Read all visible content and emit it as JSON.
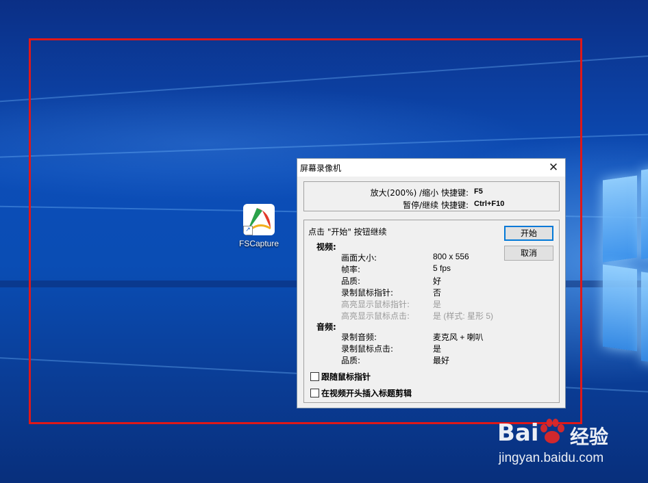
{
  "desktop": {
    "icon_label": "FSCapture"
  },
  "dialog": {
    "title": "屏幕录像机",
    "close_glyph": "✕",
    "hotkeys": {
      "zoom_label": "放大(200%) /缩小 快捷键:",
      "zoom_key": "F5",
      "pause_label": "暂停/继续 快捷键:",
      "pause_key": "Ctrl+F10"
    },
    "prompt": "点击 \"开始\" 按钮继续",
    "start_button": "开始",
    "cancel_button": "取消",
    "video": {
      "heading": "视频:",
      "items": [
        {
          "label": "画面大小:",
          "value": "800 x 556",
          "disabled": false
        },
        {
          "label": "帧率:",
          "value": "5 fps",
          "disabled": false
        },
        {
          "label": "品质:",
          "value": "好",
          "disabled": false
        },
        {
          "label": "录制鼠标指针:",
          "value": "否",
          "disabled": false
        },
        {
          "label": "高亮显示鼠标指针:",
          "value": "是",
          "disabled": true
        },
        {
          "label": "高亮显示鼠标点击:",
          "value": "是 (样式: 星形 5)",
          "disabled": true
        }
      ]
    },
    "audio": {
      "heading": "音频:",
      "items": [
        {
          "label": "录制音频:",
          "value": "麦克风 + 喇叭"
        },
        {
          "label": "录制鼠标点击:",
          "value": "是"
        },
        {
          "label": "品质:",
          "value": "最好"
        }
      ]
    },
    "checkboxes": [
      {
        "label": "跟随鼠标指针",
        "checked": false
      },
      {
        "label": "在视频开头插入标题剪辑",
        "checked": false
      }
    ]
  },
  "watermark": {
    "brand": "Bai",
    "brand_suffix": "经验",
    "url": "jingyan.baidu.com"
  },
  "colors": {
    "capture_frame": "#e01818",
    "focus_border": "#0078d7",
    "disabled_text": "#9a9a9a"
  }
}
